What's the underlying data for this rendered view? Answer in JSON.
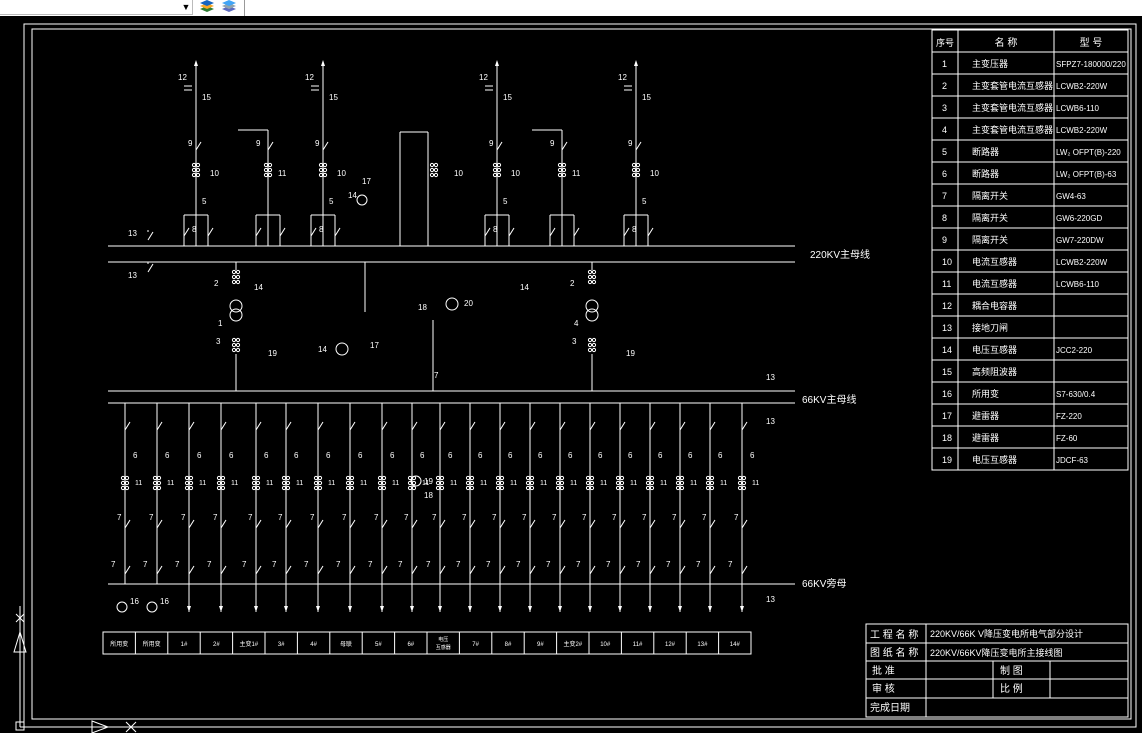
{
  "toolbar": {
    "layer_combo_value": "",
    "icons": [
      "layer-stack-icon",
      "layer-states-icon"
    ]
  },
  "bus_labels": {
    "bus_220": "220KV主母线",
    "bus_66": "66KV主母线",
    "bus_66_bypass": "66KV旁母"
  },
  "component_numbers": [
    "1",
    "2",
    "3",
    "4",
    "5",
    "6",
    "7",
    "8",
    "9",
    "10",
    "11",
    "12",
    "13",
    "14",
    "15",
    "16",
    "17",
    "18",
    "19",
    "20"
  ],
  "parts_table": {
    "headers": [
      "序号",
      "名 称",
      "型 号"
    ],
    "rows": [
      {
        "no": "1",
        "name": "主变压器",
        "model": "SFPZ7-180000/220"
      },
      {
        "no": "2",
        "name": "主变套管电流互感器",
        "model": "LCWB2-220W"
      },
      {
        "no": "3",
        "name": "主变套管电流互感器",
        "model": "LCWB6-110"
      },
      {
        "no": "4",
        "name": "主变套管电流互感器",
        "model": "LCWB2-220W"
      },
      {
        "no": "5",
        "name": "断路器",
        "model": "LW₂ OFPT(B)-220"
      },
      {
        "no": "6",
        "name": "断路器",
        "model": "LW₂ OFPT(B)-63"
      },
      {
        "no": "7",
        "name": "隔离开关",
        "model": "GW4-63"
      },
      {
        "no": "8",
        "name": "隔离开关",
        "model": "GW6-220GD"
      },
      {
        "no": "9",
        "name": "隔离开关",
        "model": "GW7-220DW"
      },
      {
        "no": "10",
        "name": "电流互感器",
        "model": "LCWB2-220W"
      },
      {
        "no": "11",
        "name": "电流互感器",
        "model": "LCWB6-110"
      },
      {
        "no": "12",
        "name": "耦合电容器",
        "model": ""
      },
      {
        "no": "13",
        "name": "接地刀闸",
        "model": ""
      },
      {
        "no": "14",
        "name": "电压互感器",
        "model": "JCC2-220"
      },
      {
        "no": "15",
        "name": "高频阻波器",
        "model": ""
      },
      {
        "no": "16",
        "name": "所用变",
        "model": "S7-630/0.4"
      },
      {
        "no": "17",
        "name": "避雷器",
        "model": "FZ-220"
      },
      {
        "no": "18",
        "name": "避雷器",
        "model": "FZ-60"
      },
      {
        "no": "19",
        "name": "电压互感器",
        "model": "JDCF-63"
      }
    ]
  },
  "feeder_labels": [
    "所用变",
    "所用变",
    "1#",
    "2#",
    "主变1#",
    "3#",
    "4#",
    "母联",
    "5#",
    "6#",
    "电压\n互感器",
    "7#",
    "8#",
    "9#",
    "主变2#",
    "10#",
    "11#",
    "12#",
    "13#",
    "14#"
  ],
  "title_block": {
    "project_label": "工 程 名 称",
    "project_value": "220KV/66K V降压变电所电气部分设计",
    "drawing_label": "图 纸 名 称",
    "drawing_value": "220KV/66KV降压变电所主接线图",
    "approve_label": "批    准",
    "draw_label": "制    图",
    "review_label": "审    核",
    "scale_label": "比    例",
    "date_label": "完成日期"
  }
}
